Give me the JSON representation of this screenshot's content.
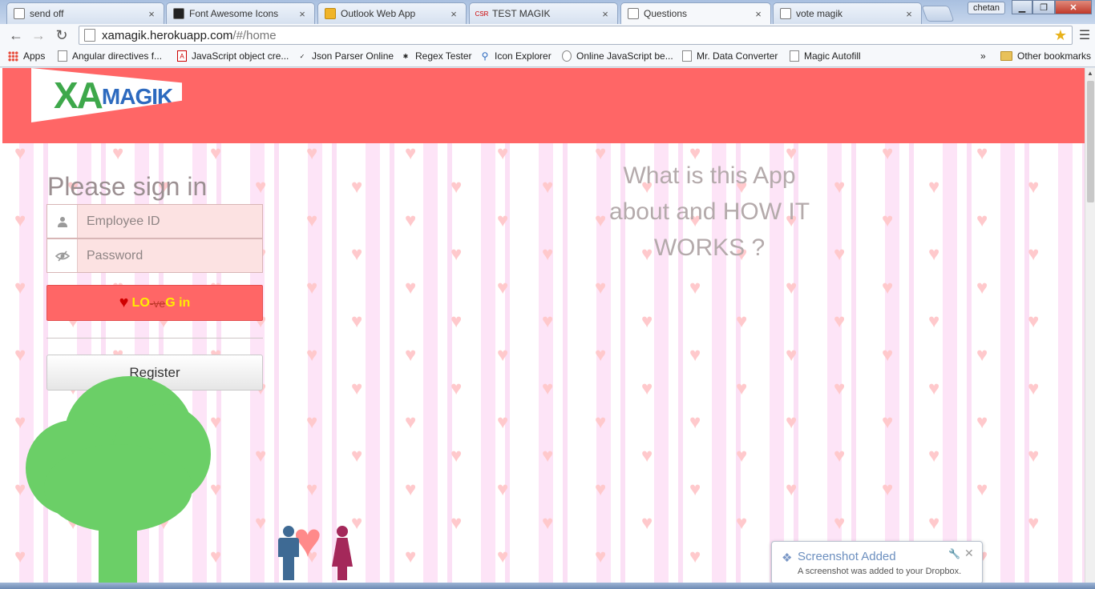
{
  "browser": {
    "tabs": [
      {
        "title": "send off",
        "favicon": "page-icon",
        "active": false
      },
      {
        "title": "Font Awesome Icons",
        "favicon": "font-awesome-icon",
        "active": false
      },
      {
        "title": "Outlook Web App",
        "favicon": "outlook-icon",
        "active": false
      },
      {
        "title": "TEST MAGIK",
        "favicon": "csr-icon",
        "active": false
      },
      {
        "title": "Questions",
        "favicon": "page-icon",
        "active": true
      },
      {
        "title": "vote magik",
        "favicon": "page-icon",
        "active": false
      }
    ],
    "tab_close_glyph": "×",
    "user": "chetan",
    "url_host": "xamagik.herokuapp.com",
    "url_path": "/#/home",
    "bookmarks": [
      {
        "label": "Apps",
        "icon": "apps-grid-icon"
      },
      {
        "label": "Angular directives f...",
        "icon": "page-icon"
      },
      {
        "label": "JavaScript object cre...",
        "icon": "adobe-icon"
      },
      {
        "label": "Json Parser Online",
        "icon": "json-icon"
      },
      {
        "label": "Regex Tester",
        "icon": "regex-icon"
      },
      {
        "label": "Icon Explorer",
        "icon": "search-icon"
      },
      {
        "label": "Online JavaScript be...",
        "icon": "owl-icon"
      },
      {
        "label": "Mr. Data Converter",
        "icon": "page-icon"
      },
      {
        "label": "Magic Autofill",
        "icon": "page-icon"
      }
    ],
    "bookmarks_overflow": "»",
    "other_bookmarks": "Other bookmarks"
  },
  "header": {
    "logo_big": "XA",
    "logo_small": "MAGIK",
    "bg_color": "#ff6666"
  },
  "signin": {
    "title": "Please sign in",
    "employee_placeholder": "Employee ID",
    "password_placeholder": "Password",
    "login_part1": "LO",
    "login_part2": "-ve",
    "login_part3": "G in",
    "register_label": "Register"
  },
  "about": {
    "line1": "What is this App",
    "line2": "about and HOW IT",
    "line3": "WORKS ?"
  },
  "toast": {
    "title": "Screenshot Added",
    "message": "A screenshot was added to your Dropbox.",
    "icon": "dropbox-icon"
  },
  "colors": {
    "accent": "#ff6666",
    "tree": "#6bcf67",
    "heart_bg": "#ffc9cc",
    "login_text": "#ffee00"
  }
}
